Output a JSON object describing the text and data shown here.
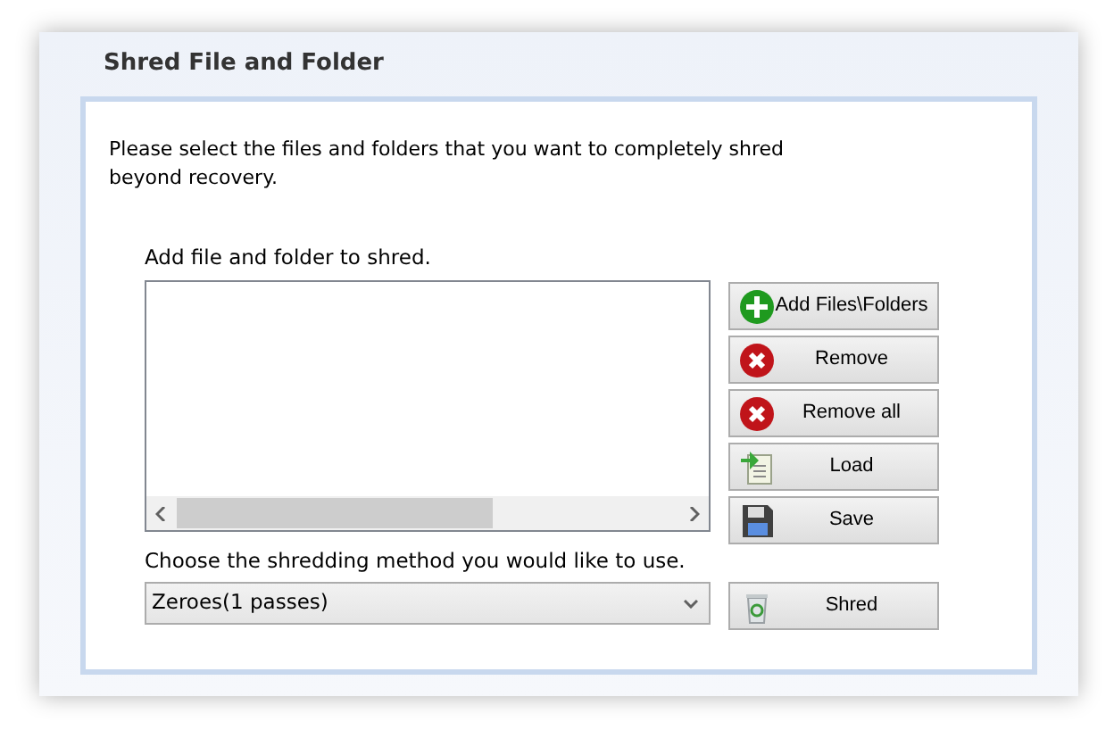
{
  "window": {
    "title": "Shred File and Folder"
  },
  "description": "Please select the files and folders that you want to completely shred beyond recovery.",
  "file_list": {
    "label": "Add file and folder to shred."
  },
  "buttons": [
    {
      "label": "Add Files\\Folders",
      "kind": "add"
    },
    {
      "label": "Remove",
      "kind": "remove"
    },
    {
      "label": "Remove all",
      "kind": "remove"
    },
    {
      "label": "Load",
      "kind": "load"
    },
    {
      "label": "Save",
      "kind": "save"
    }
  ],
  "method": {
    "label": "Choose the shredding method you would like to use.",
    "value": "Zeroes(1 passes)"
  },
  "shred_button": {
    "label": "Shred",
    "kind": "shred"
  }
}
